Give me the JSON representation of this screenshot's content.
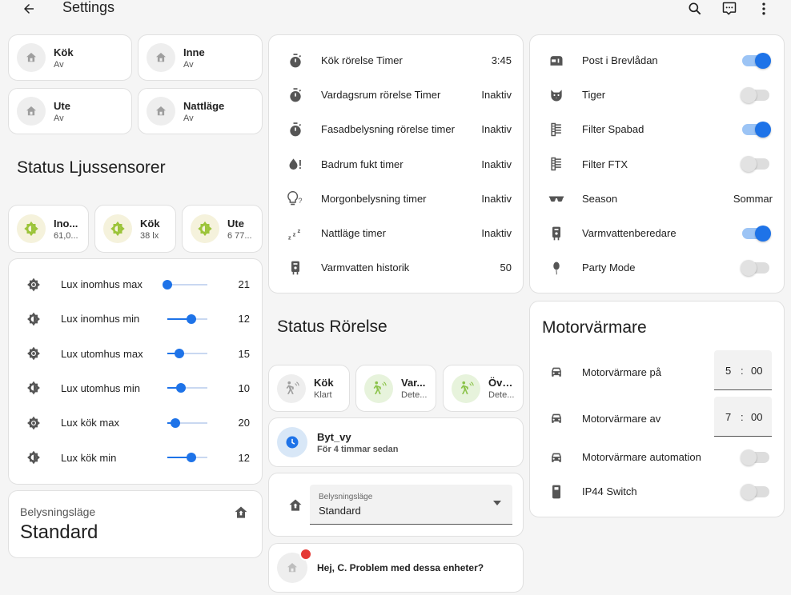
{
  "topbar": {
    "title": "Settings"
  },
  "colors": {
    "accent": "#1e73e8",
    "alert": "#e53935"
  },
  "modes": [
    {
      "name": "Kök",
      "state": "Av"
    },
    {
      "name": "Inne",
      "state": "Av"
    },
    {
      "name": "Ute",
      "state": "Av"
    },
    {
      "name": "Nattläge",
      "state": "Av"
    }
  ],
  "light_sensors": {
    "heading": "Status Ljussensorer",
    "tiles": [
      {
        "name": "Ino...",
        "value": "61,0..."
      },
      {
        "name": "Kök",
        "value": "38 lx"
      },
      {
        "name": "Ute",
        "value": "6 77..."
      }
    ]
  },
  "lux": {
    "rows": [
      {
        "label": "Lux inomhus max",
        "value": "21",
        "level": 0.0,
        "icon": "brightness-icon"
      },
      {
        "label": "Lux inomhus min",
        "value": "12",
        "level": 0.6,
        "icon": "brightness-half-icon"
      },
      {
        "label": "Lux utomhus max",
        "value": "15",
        "level": 0.3,
        "icon": "brightness-icon"
      },
      {
        "label": "Lux utomhus min",
        "value": "10",
        "level": 0.34,
        "icon": "brightness-half-icon"
      },
      {
        "label": "Lux kök max",
        "value": "20",
        "level": 0.2,
        "icon": "brightness-icon"
      },
      {
        "label": "Lux kök min",
        "value": "12",
        "level": 0.6,
        "icon": "brightness-half-icon"
      }
    ]
  },
  "belysning": {
    "label": "Belysningsläge",
    "value": "Standard"
  },
  "timers": [
    {
      "label": "Kök rörelse Timer",
      "value": "3:45",
      "icon": "timer-icon"
    },
    {
      "label": "Vardagsrum rörelse Timer",
      "value": "Inaktiv",
      "icon": "timer-icon"
    },
    {
      "label": "Fasadbelysning rörelse timer",
      "value": "Inaktiv",
      "icon": "timer-icon"
    },
    {
      "label": "Badrum fukt timer",
      "value": "Inaktiv",
      "icon": "water-alert-icon"
    },
    {
      "label": "Morgonbelysning timer",
      "value": "Inaktiv",
      "icon": "lightbulb-question-icon"
    },
    {
      "label": "Nattläge timer",
      "value": "Inaktiv",
      "icon": "sleep-icon"
    },
    {
      "label": "Varmvatten historik",
      "value": "50",
      "icon": "water-boiler-icon"
    }
  ],
  "motion": {
    "heading": "Status Rörelse",
    "tiles": [
      {
        "name": "Kök",
        "state": "Klart"
      },
      {
        "name": "Var...",
        "state": "Dete..."
      },
      {
        "name": "Öve...",
        "state": "Dete..."
      }
    ]
  },
  "bytvy": {
    "title": "Byt_vy",
    "subtitle": "För 4 timmar sedan"
  },
  "select": {
    "label": "Belysningsläge",
    "value": "Standard"
  },
  "problem": {
    "text": "Hej, C. Problem med dessa enheter?"
  },
  "toggles": [
    {
      "label": "Post i Brevlådan",
      "on": true,
      "icon": "mailbox-icon"
    },
    {
      "label": "Tiger",
      "on": false,
      "icon": "cat-icon"
    },
    {
      "label": "Filter Spabad",
      "on": true,
      "icon": "air-filter-icon"
    },
    {
      "label": "Filter FTX",
      "on": false,
      "icon": "air-filter-icon"
    },
    {
      "label": "Season",
      "value": "Sommar",
      "icon": "sunglasses-icon"
    },
    {
      "label": "Varmvattenberedare",
      "on": true,
      "icon": "water-boiler-icon"
    },
    {
      "label": "Party Mode",
      "on": false,
      "icon": "balloon-icon"
    }
  ],
  "motorvarmare": {
    "heading": "Motorvärmare",
    "on_time": {
      "label": "Motorvärmare på",
      "hour": "5",
      "minute": "00"
    },
    "off_time": {
      "label": "Motorvärmare av",
      "hour": "7",
      "minute": "00"
    },
    "automation": {
      "label": "Motorvärmare automation",
      "on": false
    },
    "ip44": {
      "label": "IP44 Switch",
      "on": false
    }
  }
}
